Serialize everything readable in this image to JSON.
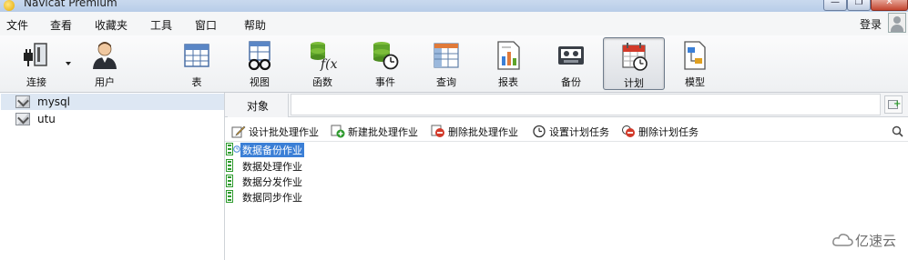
{
  "window": {
    "title": "Navicat Premium"
  },
  "window_controls": {
    "minimize": "—",
    "maximize": "❐",
    "close": "✕"
  },
  "menu": [
    "文件",
    "查看",
    "收藏夹",
    "工具",
    "窗口",
    "帮助"
  ],
  "login": {
    "label": "登录"
  },
  "toolbar": {
    "items": [
      {
        "label": "连接",
        "icon": "plug-icon"
      },
      {
        "label": "用户",
        "icon": "user-icon"
      },
      {
        "label": "表",
        "icon": "table-icon"
      },
      {
        "label": "视图",
        "icon": "view-icon"
      },
      {
        "label": "函数",
        "icon": "function-icon"
      },
      {
        "label": "事件",
        "icon": "event-icon"
      },
      {
        "label": "查询",
        "icon": "query-icon"
      },
      {
        "label": "报表",
        "icon": "report-icon"
      },
      {
        "label": "备份",
        "icon": "backup-icon"
      },
      {
        "label": "计划",
        "icon": "schedule-icon"
      },
      {
        "label": "模型",
        "icon": "model-icon"
      }
    ],
    "active": "计划"
  },
  "connections": [
    {
      "name": "mysql",
      "selected": true
    },
    {
      "name": "utu",
      "selected": false
    }
  ],
  "tabs": [
    {
      "label": "对象"
    }
  ],
  "actions": [
    {
      "label": "设计批处理作业",
      "icon": "design-icon"
    },
    {
      "label": "新建批处理作业",
      "icon": "new-icon"
    },
    {
      "label": "删除批处理作业",
      "icon": "delete-icon"
    },
    {
      "label": "设置计划任务",
      "icon": "clock-icon"
    },
    {
      "label": "删除计划任务",
      "icon": "delete-schedule-icon"
    }
  ],
  "jobs": [
    {
      "name": "数据备份作业",
      "selected": true
    },
    {
      "name": "数据处理作业",
      "selected": false
    },
    {
      "name": "数据分发作业",
      "selected": false
    },
    {
      "name": "数据同步作业",
      "selected": false
    }
  ],
  "watermark": {
    "text": "亿速云"
  },
  "colors": {
    "selection": "#3b7fd6",
    "accent_green": "#2d9a2d",
    "accent_red": "#d23a2a"
  }
}
